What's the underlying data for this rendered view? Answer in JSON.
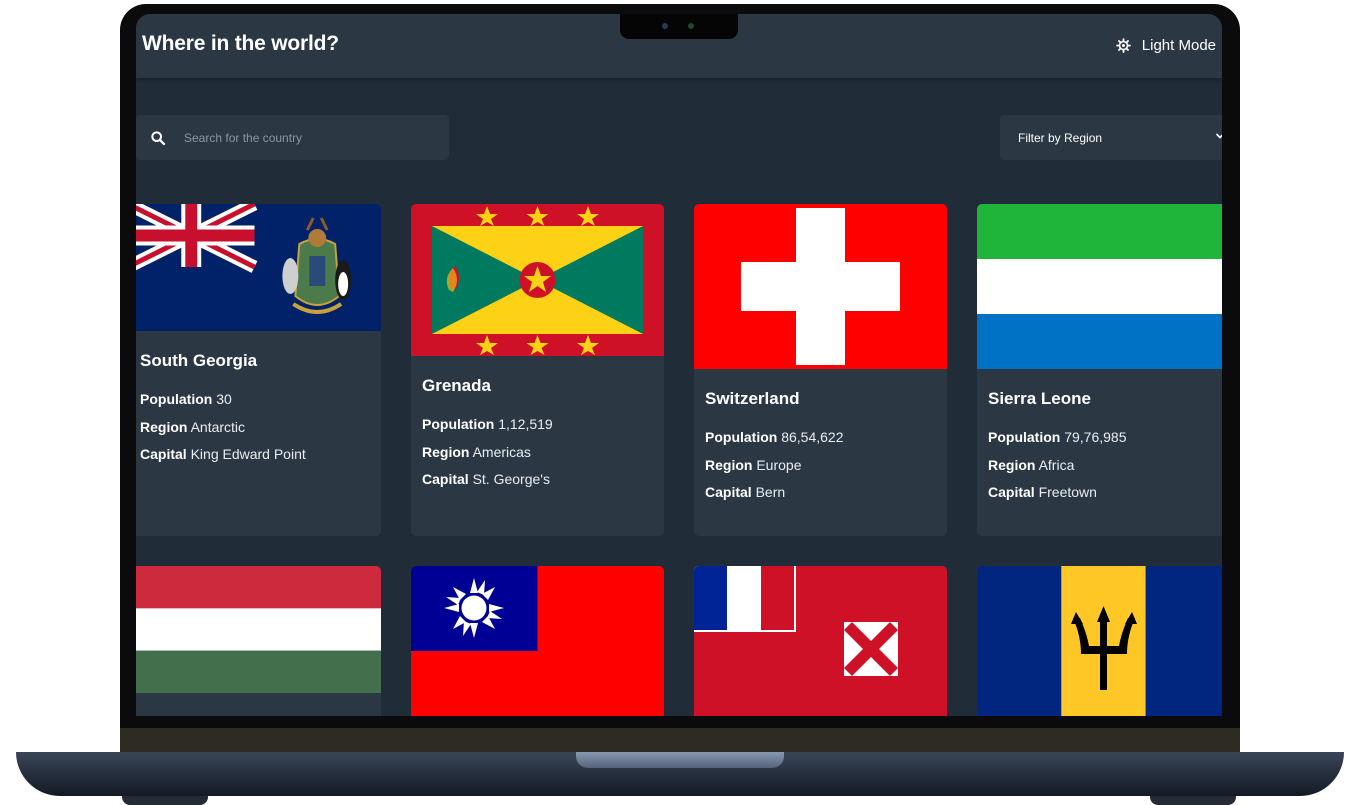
{
  "header": {
    "title": "Where in the world?",
    "theme_toggle_label": "Light Mode"
  },
  "search": {
    "placeholder": "Search for the country"
  },
  "filter": {
    "label": "Filter by Region"
  },
  "labels": {
    "population": "Population",
    "region": "Region",
    "capital": "Capital"
  },
  "countries": [
    {
      "name": "South Georgia",
      "population": "30",
      "region": "Antarctic",
      "capital": "King Edward Point",
      "flag": "south-georgia-flag"
    },
    {
      "name": "Grenada",
      "population": "1,12,519",
      "region": "Americas",
      "capital": "St. George's",
      "flag": "grenada-flag"
    },
    {
      "name": "Switzerland",
      "population": "86,54,622",
      "region": "Europe",
      "capital": "Bern",
      "flag": "switzerland-flag"
    },
    {
      "name": "Sierra Leone",
      "population": "79,76,985",
      "region": "Africa",
      "capital": "Freetown",
      "flag": "sierra-leone-flag"
    },
    {
      "name": "",
      "flag": "hungary-flag"
    },
    {
      "name": "",
      "flag": "taiwan-flag"
    },
    {
      "name": "",
      "flag": "wallis-and-futuna-flag"
    },
    {
      "name": "",
      "flag": "barbados-flag"
    }
  ],
  "colors": {
    "background": "#202c37",
    "elements": "#2b3844",
    "text": "#ffffff"
  }
}
